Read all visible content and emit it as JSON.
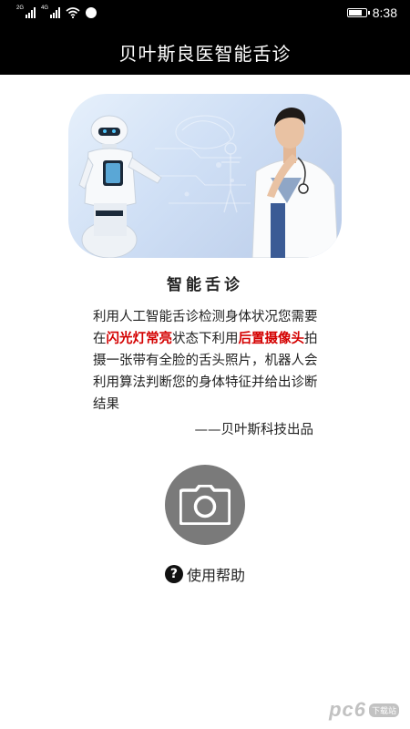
{
  "status_bar": {
    "time": "8:38",
    "sim1_tag": "2G",
    "sim2_tag": "4G",
    "battery_level": 0.85,
    "icons": [
      "signal-icon",
      "signal-icon",
      "wifi-icon",
      "notification-icon",
      "battery-icon"
    ]
  },
  "app_bar": {
    "title": "贝叶斯良医智能舌诊"
  },
  "hero": {
    "image": "robot-and-doctor-illustration"
  },
  "content": {
    "title": "智能舌诊",
    "desc_1": "利用人工智能舌诊检测身体状况您需要在",
    "desc_red_1": "闪光灯常亮",
    "desc_2": "状态下利用",
    "desc_red_2": "后置摄像头",
    "desc_3": "拍摄一张带有全脸的舌头照片，机器人会利用算法判断您的身体特征并给出诊断结果",
    "signature": "——贝叶斯科技出品"
  },
  "camera": {
    "icon": "camera-icon"
  },
  "help": {
    "icon": "question-icon",
    "icon_glyph": "?",
    "label": "使用帮助"
  },
  "watermark": {
    "logo": "pc6",
    "site": "下载站"
  },
  "colors": {
    "app_bar_bg": "#000000",
    "highlight_red": "#d40000",
    "camera_button": "#7a7a7a"
  }
}
